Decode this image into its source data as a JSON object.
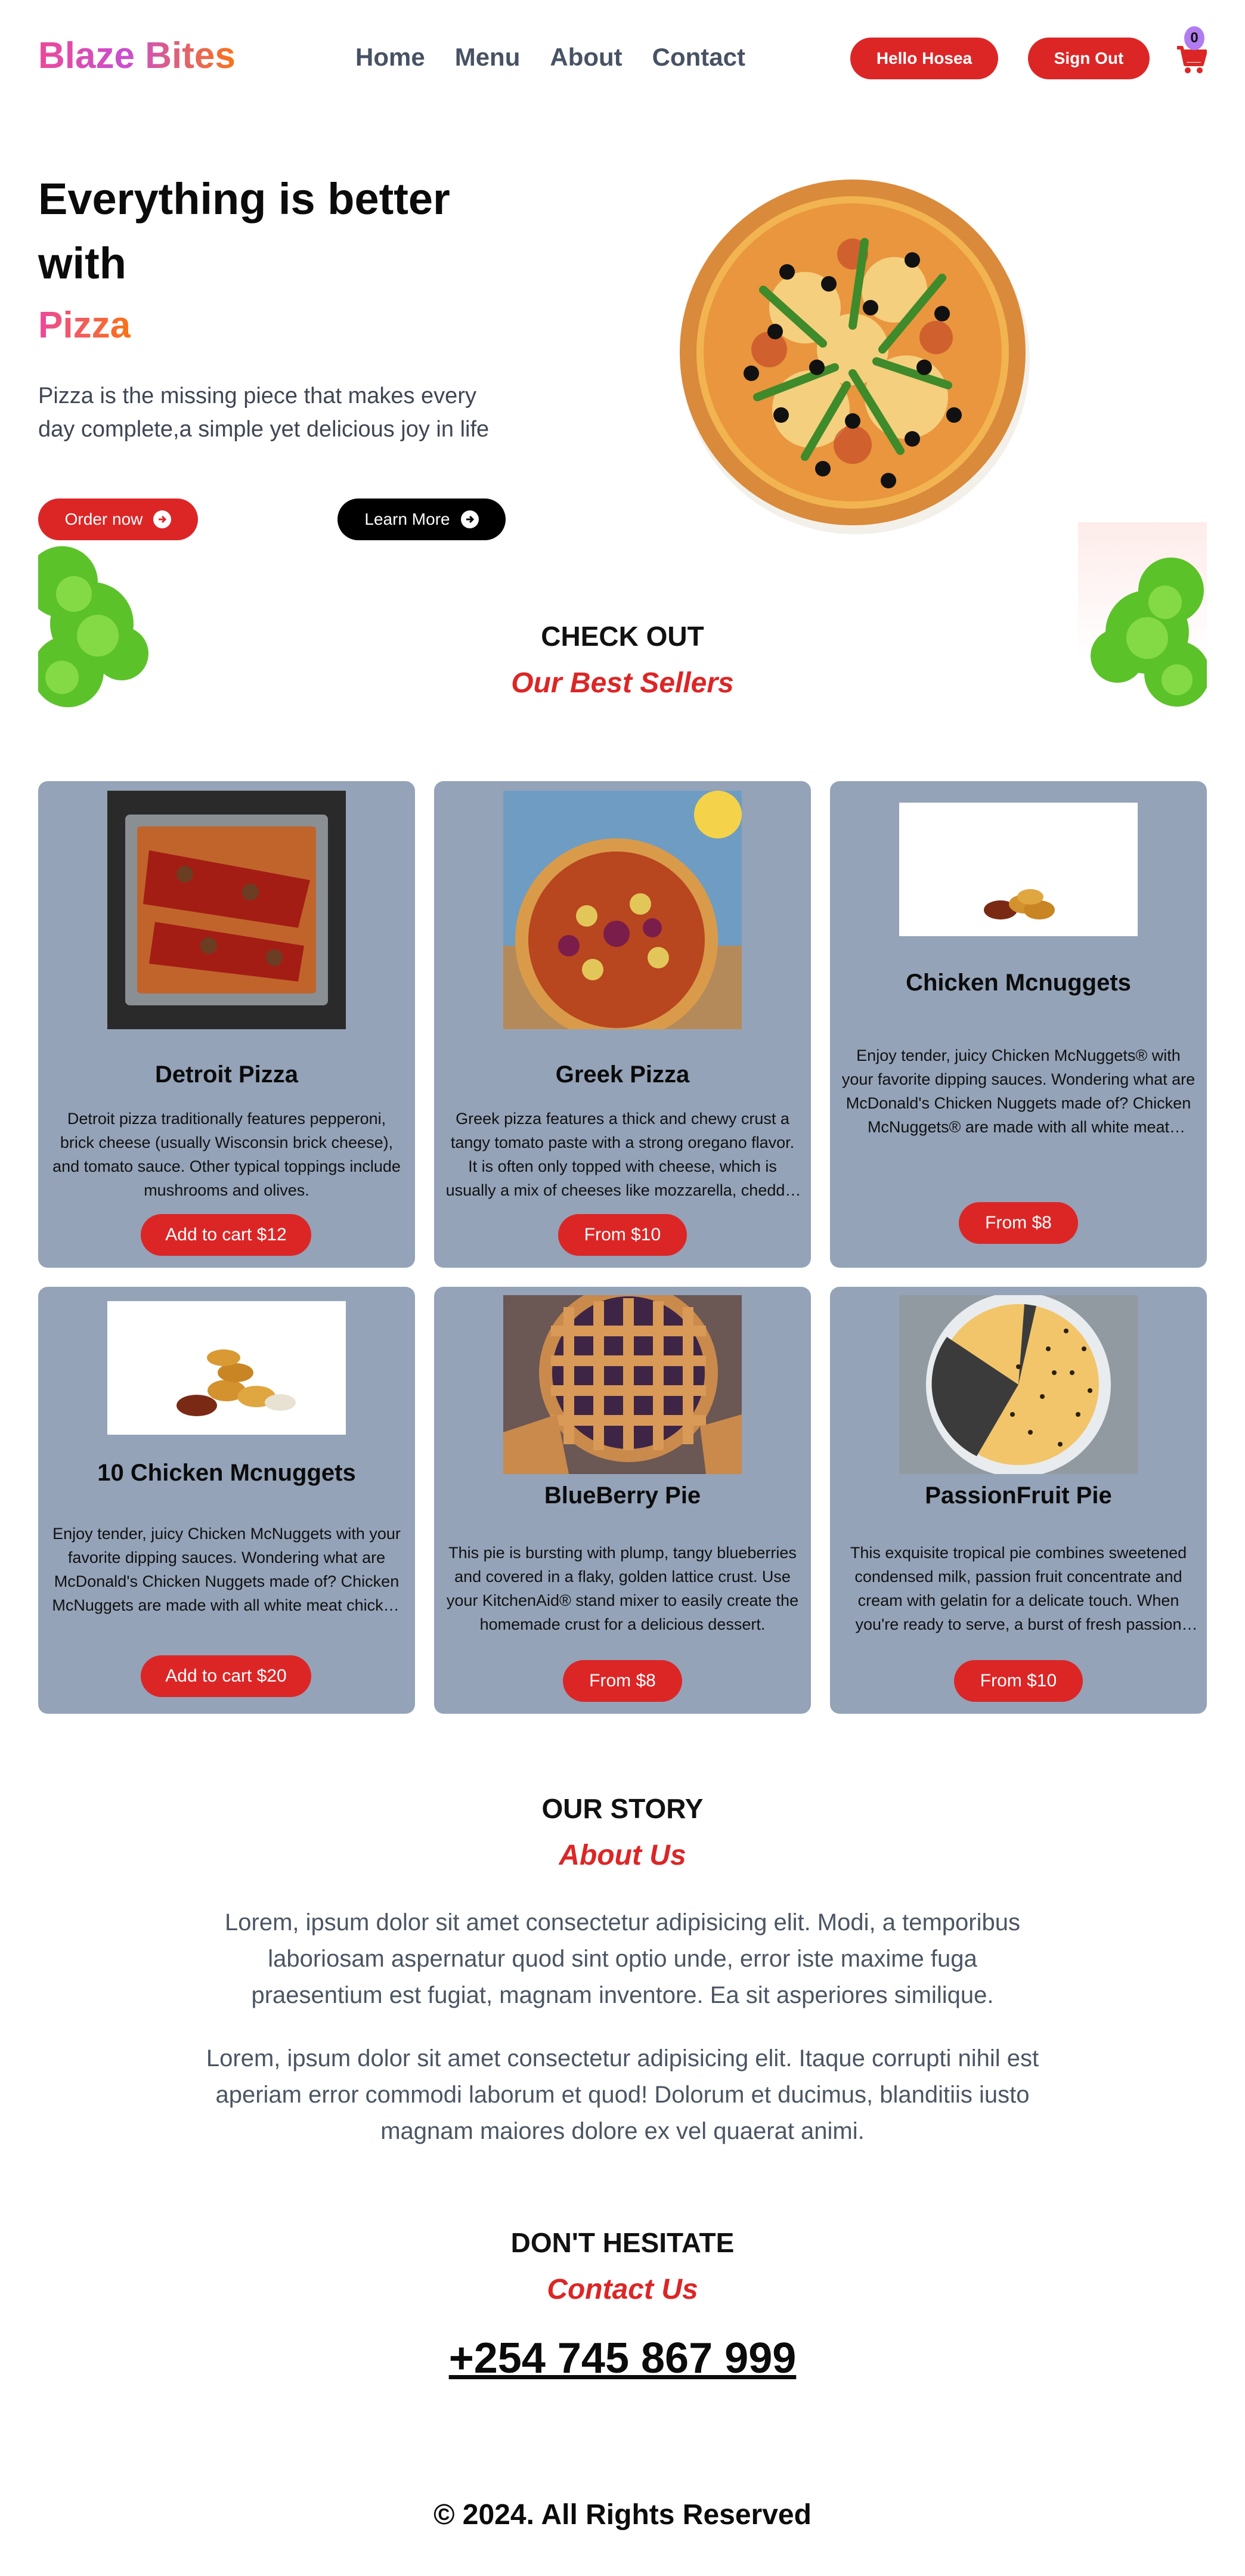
{
  "brand": {
    "name": "Blaze Bites"
  },
  "nav": {
    "links": [
      "Home",
      "Menu",
      "About",
      "Contact"
    ]
  },
  "header": {
    "hello": "Hello Hosea",
    "signout": "Sign Out",
    "cart_count": "0",
    "cart_icon": "cart-icon"
  },
  "hero": {
    "title": "Everything is better with",
    "accent": "Pizza",
    "description": "Pizza is the missing piece that makes every day complete,a simple yet delicious joy in life",
    "order_label": "Order now",
    "learn_label": "Learn More"
  },
  "best_sellers": {
    "kicker": "CHECK OUT",
    "heading": "Our Best Sellers"
  },
  "products": [
    {
      "name": "Detroit Pizza",
      "description": "Detroit pizza traditionally features pepperoni, brick cheese (usually Wisconsin brick cheese), and tomato sauce. Other typical toppings include mushrooms and olives.",
      "button": "Add to cart $12"
    },
    {
      "name": "Greek Pizza",
      "description": "Greek pizza features a thick and chewy crust a tangy tomato paste with a strong oregano flavor. It is often only topped with cheese, which is usually a mix of cheeses like mozzarella, cheddar and provolone.",
      "button": "From $10"
    },
    {
      "name": "Chicken Mcnuggets",
      "description": "Enjoy tender, juicy Chicken McNuggets® with your favorite dipping sauces. Wondering what are McDonald's Chicken Nuggets made of? Chicken McNuggets® are made with all white meat chicken and no artificial colors, flavors, or preservatives.",
      "button": "From $8"
    },
    {
      "name": "10 Chicken Mcnuggets",
      "description": "Enjoy tender, juicy Chicken McNuggets with your favorite dipping sauces. Wondering what are McDonald's Chicken Nuggets made of? Chicken McNuggets are made with all white meat chicken and no artificial colors, flavors, or preservatives.",
      "button": "Add to cart $20"
    },
    {
      "name": "BlueBerry Pie",
      "description": "This pie is bursting with plump, tangy blueberries and covered in a flaky, golden lattice crust. Use your KitchenAid® stand mixer to easily create the homemade crust for a delicious dessert.",
      "button": "From $8"
    },
    {
      "name": "PassionFruit Pie",
      "description": "This exquisite tropical pie combines sweetened condensed milk, passion fruit concentrate and cream with gelatin for a delicate touch. When you're ready to serve, a burst of fresh passion fruit pulp tops it off.",
      "button": "From $10"
    }
  ],
  "story": {
    "kicker": "OUR STORY",
    "heading": "About Us",
    "para1": "Lorem, ipsum dolor sit amet consectetur adipisicing elit. Modi, a temporibus laboriosam aspernatur quod sint optio unde, error iste maxime fuga praesentium est fugiat, magnam inventore. Ea sit asperiores similique.",
    "para2": "Lorem, ipsum dolor sit amet consectetur adipisicing elit. Itaque corrupti nihil est aperiam error commodi laborum et quod! Dolorum et ducimus, blanditiis iusto magnam maiores dolore ex vel quaerat animi."
  },
  "contact": {
    "kicker": "DON'T HESITATE",
    "heading": "Contact Us",
    "phone": "+254 745 867 999"
  },
  "footer": {
    "text": "© 2024. All Rights Reserved"
  },
  "colors": {
    "accent": "#dc2626",
    "card_bg": "#94a3b8",
    "nav_text": "#475264"
  }
}
